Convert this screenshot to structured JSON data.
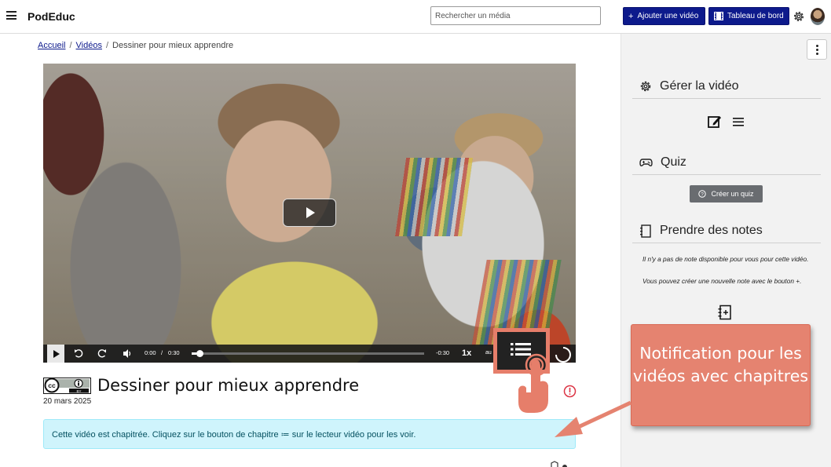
{
  "header": {
    "brand": "PodEduc",
    "search_placeholder": "Rechercher un média",
    "add_video_label": "Ajouter une vidéo",
    "dashboard_label": "Tableau de bord"
  },
  "breadcrumb": {
    "home": "Accueil",
    "videos": "Vidéos",
    "current": "Dessiner pour mieux apprendre",
    "separator": "/"
  },
  "player": {
    "current_time": "0:00",
    "time_sep": "/",
    "duration": "0:30",
    "remaining": "-0:30",
    "rate": "1x",
    "quality": "au",
    "progress": 0.02
  },
  "video": {
    "title": "Dessiner pour mieux apprendre",
    "date": "20 mars 2025",
    "license_icon": "cc-by-icon"
  },
  "alert": {
    "text": "Cette vidéo est chapitrée. Cliquez sur le bouton de chapitre ≔ sur le lecteur vidéo pour les voir."
  },
  "sidebar": {
    "manage_title": "Gérer la vidéo",
    "quiz_title": "Quiz",
    "quiz_button": "Créer un quiz",
    "notes_title": "Prendre des notes",
    "notes_empty_1": "Il n'y a pas de note disponible pour vous pour cette vidéo.",
    "notes_empty_2": "Vous pouvez créer une nouvelle note avec le bouton +."
  },
  "callout": {
    "text": "Notification pour les vidéos avec chapitres"
  },
  "colors": {
    "navy": "#0d1a8c",
    "callout": "#e58370",
    "alert_bg": "#cff4fc",
    "alert_text": "#055160"
  }
}
